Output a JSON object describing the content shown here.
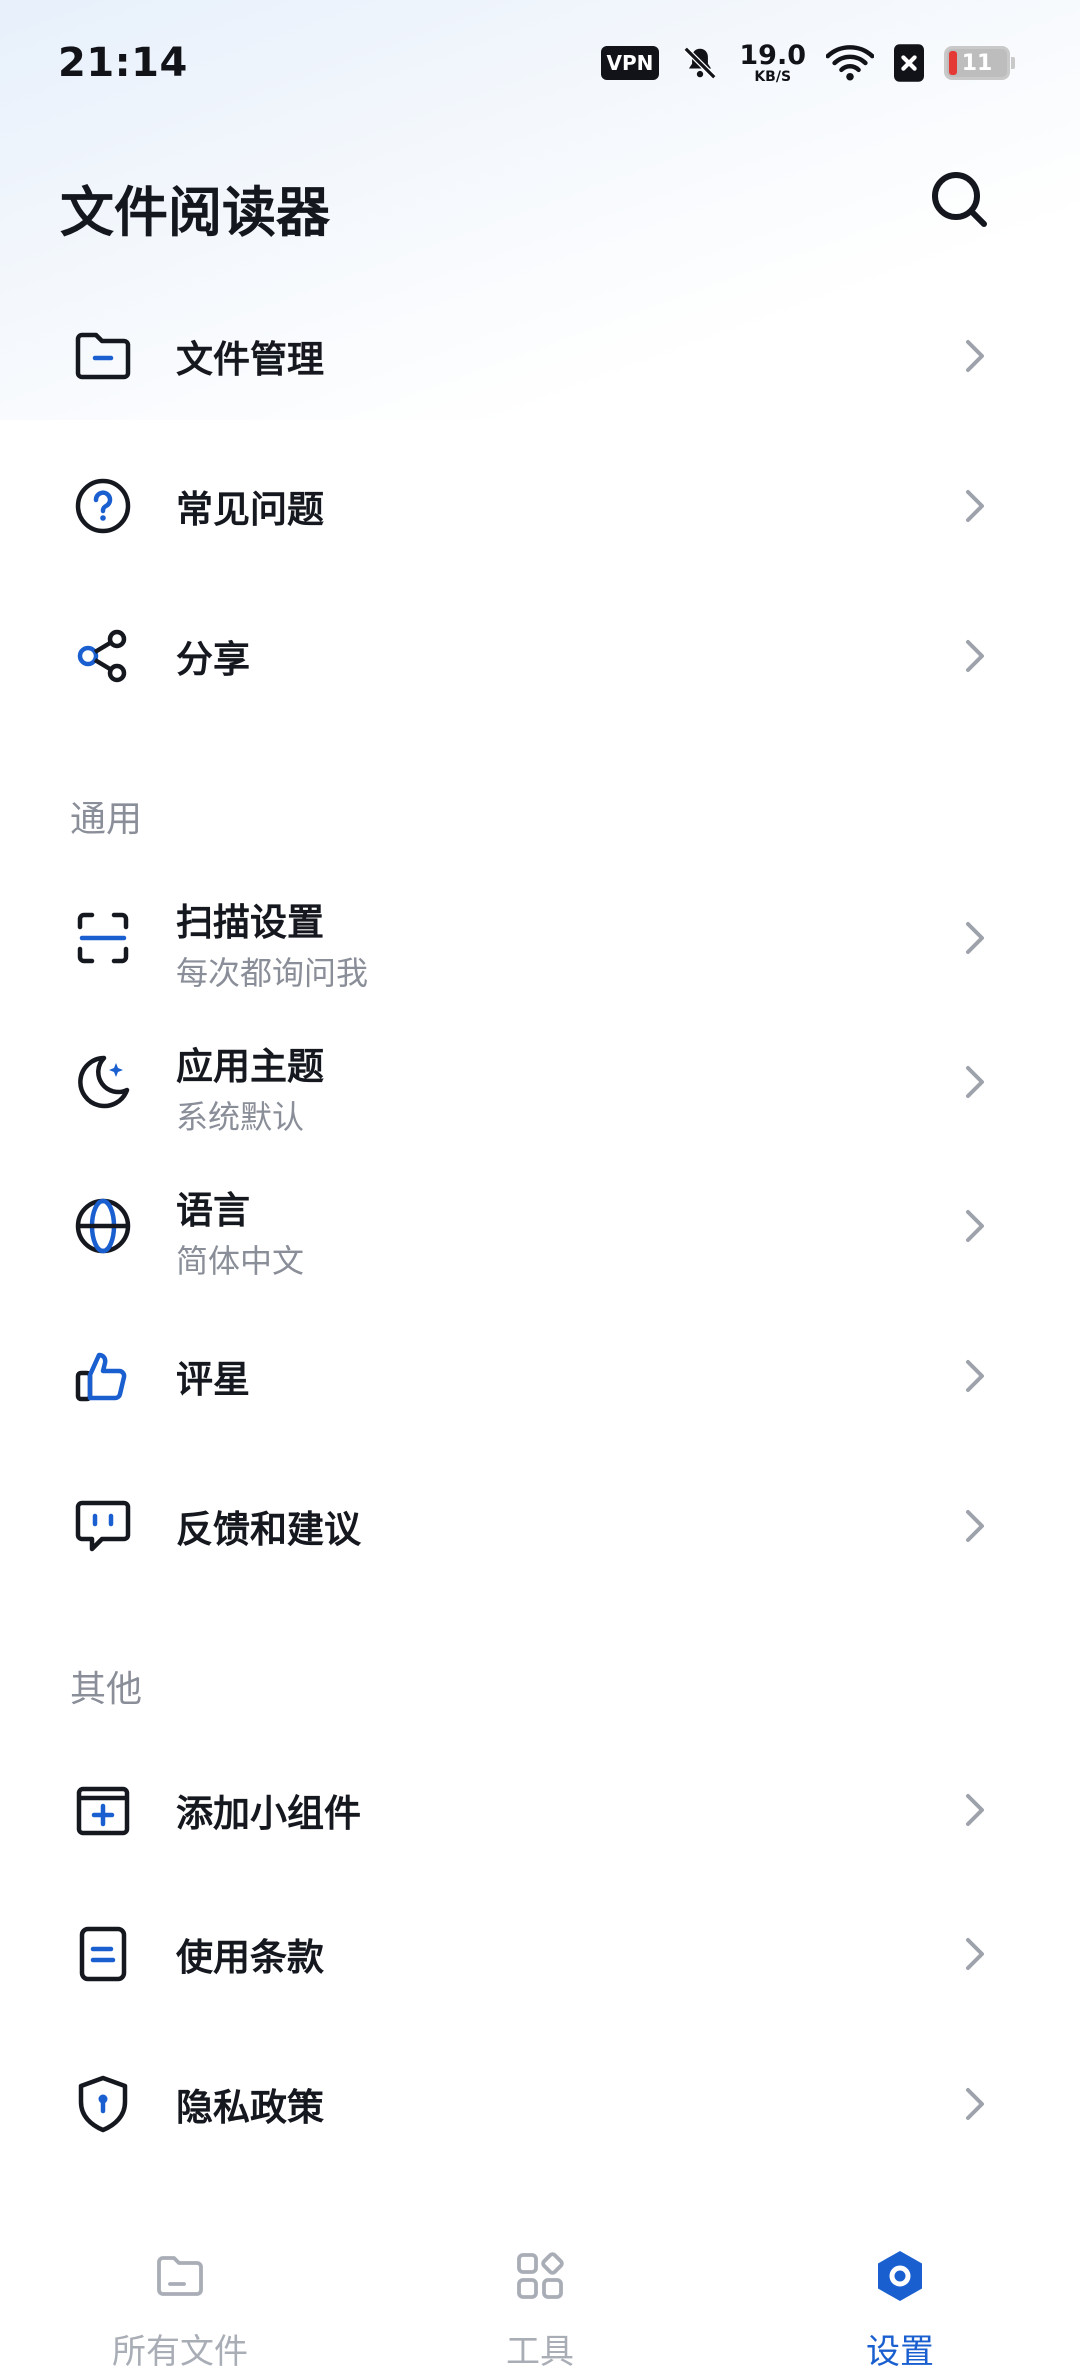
{
  "status_bar": {
    "time": "21:14",
    "vpn": "VPN",
    "speed_value": "19.0",
    "speed_unit": "KB/S",
    "battery": "11"
  },
  "header": {
    "title": "文件阅读器"
  },
  "items_top": [
    {
      "label": "文件管理",
      "icon": "folder-icon"
    },
    {
      "label": "常见问题",
      "icon": "question-icon"
    },
    {
      "label": "分享",
      "icon": "share-icon"
    }
  ],
  "section_general": {
    "title": "通用",
    "items": [
      {
        "label": "扫描设置",
        "sub": "每次都询问我",
        "icon": "scan-icon"
      },
      {
        "label": "应用主题",
        "sub": "系统默认",
        "icon": "moon-icon"
      },
      {
        "label": "语言",
        "sub": "简体中文",
        "icon": "globe-icon"
      },
      {
        "label": "评星",
        "icon": "thumbs-up-icon"
      },
      {
        "label": "反馈和建议",
        "icon": "feedback-icon"
      }
    ]
  },
  "section_other": {
    "title": "其他",
    "items": [
      {
        "label": "添加小组件",
        "icon": "widget-add-icon"
      },
      {
        "label": "使用条款",
        "icon": "document-icon"
      },
      {
        "label": "隐私政策",
        "icon": "shield-icon"
      }
    ]
  },
  "bottom_nav": {
    "items": [
      {
        "label": "所有文件",
        "icon": "folder-icon"
      },
      {
        "label": "工具",
        "icon": "grid-icon"
      },
      {
        "label": "设置",
        "icon": "settings-icon",
        "active": true
      }
    ]
  },
  "colors": {
    "accent": "#1a5fd0",
    "text_primary": "#16181f",
    "text_secondary": "#8a8e98",
    "nav_inactive": "#a9adb6"
  }
}
